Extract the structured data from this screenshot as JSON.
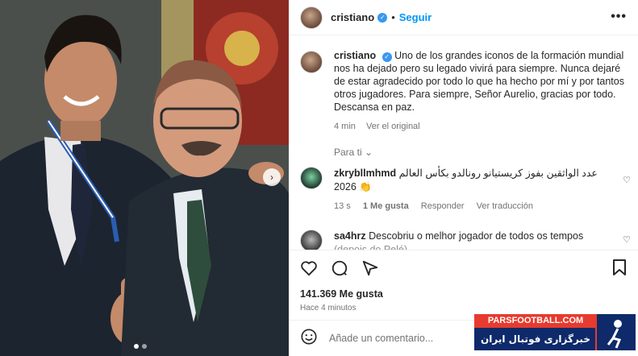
{
  "header": {
    "username": "cristiano",
    "separator": "•",
    "follow_label": "Seguir",
    "more_icon": "more-horizontal-icon"
  },
  "caption": {
    "username": "cristiano",
    "text": "Uno de los grandes iconos de la formación mundial nos ha dejado pero su legado vivirá para siempre. Nunca dejaré de estar agradecido por todo lo que ha hecho por mí y por tantos otros jugadores. Para siempre, Señor Aurelio, gracias por todo. Descansa en paz.",
    "time": "4 min",
    "translate_label": "Ver el original"
  },
  "sort_label": "Para ti",
  "comments": [
    {
      "username": "zkryb‌llmhmd",
      "text": "عدد الواثقين بفوز كريستيانو رونالدو بكأس العالم 2026",
      "emoji": "👏",
      "time": "13 s",
      "likes": "1 Me gusta",
      "reply": "Responder",
      "translate": "Ver traducción"
    },
    {
      "username": "sa4hrz",
      "text": "Descobriu o melhor jogador de todos os tempos",
      "overflow_text": "(depois do Pelé)"
    }
  ],
  "actions": {
    "like_icon": "heart-icon",
    "comment_icon": "comment-icon",
    "share_icon": "share-icon",
    "save_icon": "bookmark-icon"
  },
  "likes_count": "141.369 Me gusta",
  "posted_ago": "Hace 4 minutos",
  "add_comment": {
    "placeholder": "Añade un comentario...",
    "emoji_icon": "smiley-icon"
  },
  "watermark": {
    "site": "PARSFOOTBALL.COM",
    "tagline": "خبرگزاری فوتبال ایران"
  },
  "colors": {
    "accent": "#0095f6",
    "verified": "#3897f0",
    "watermark_red": "#e63b2e",
    "watermark_blue": "#0e2a6b"
  }
}
